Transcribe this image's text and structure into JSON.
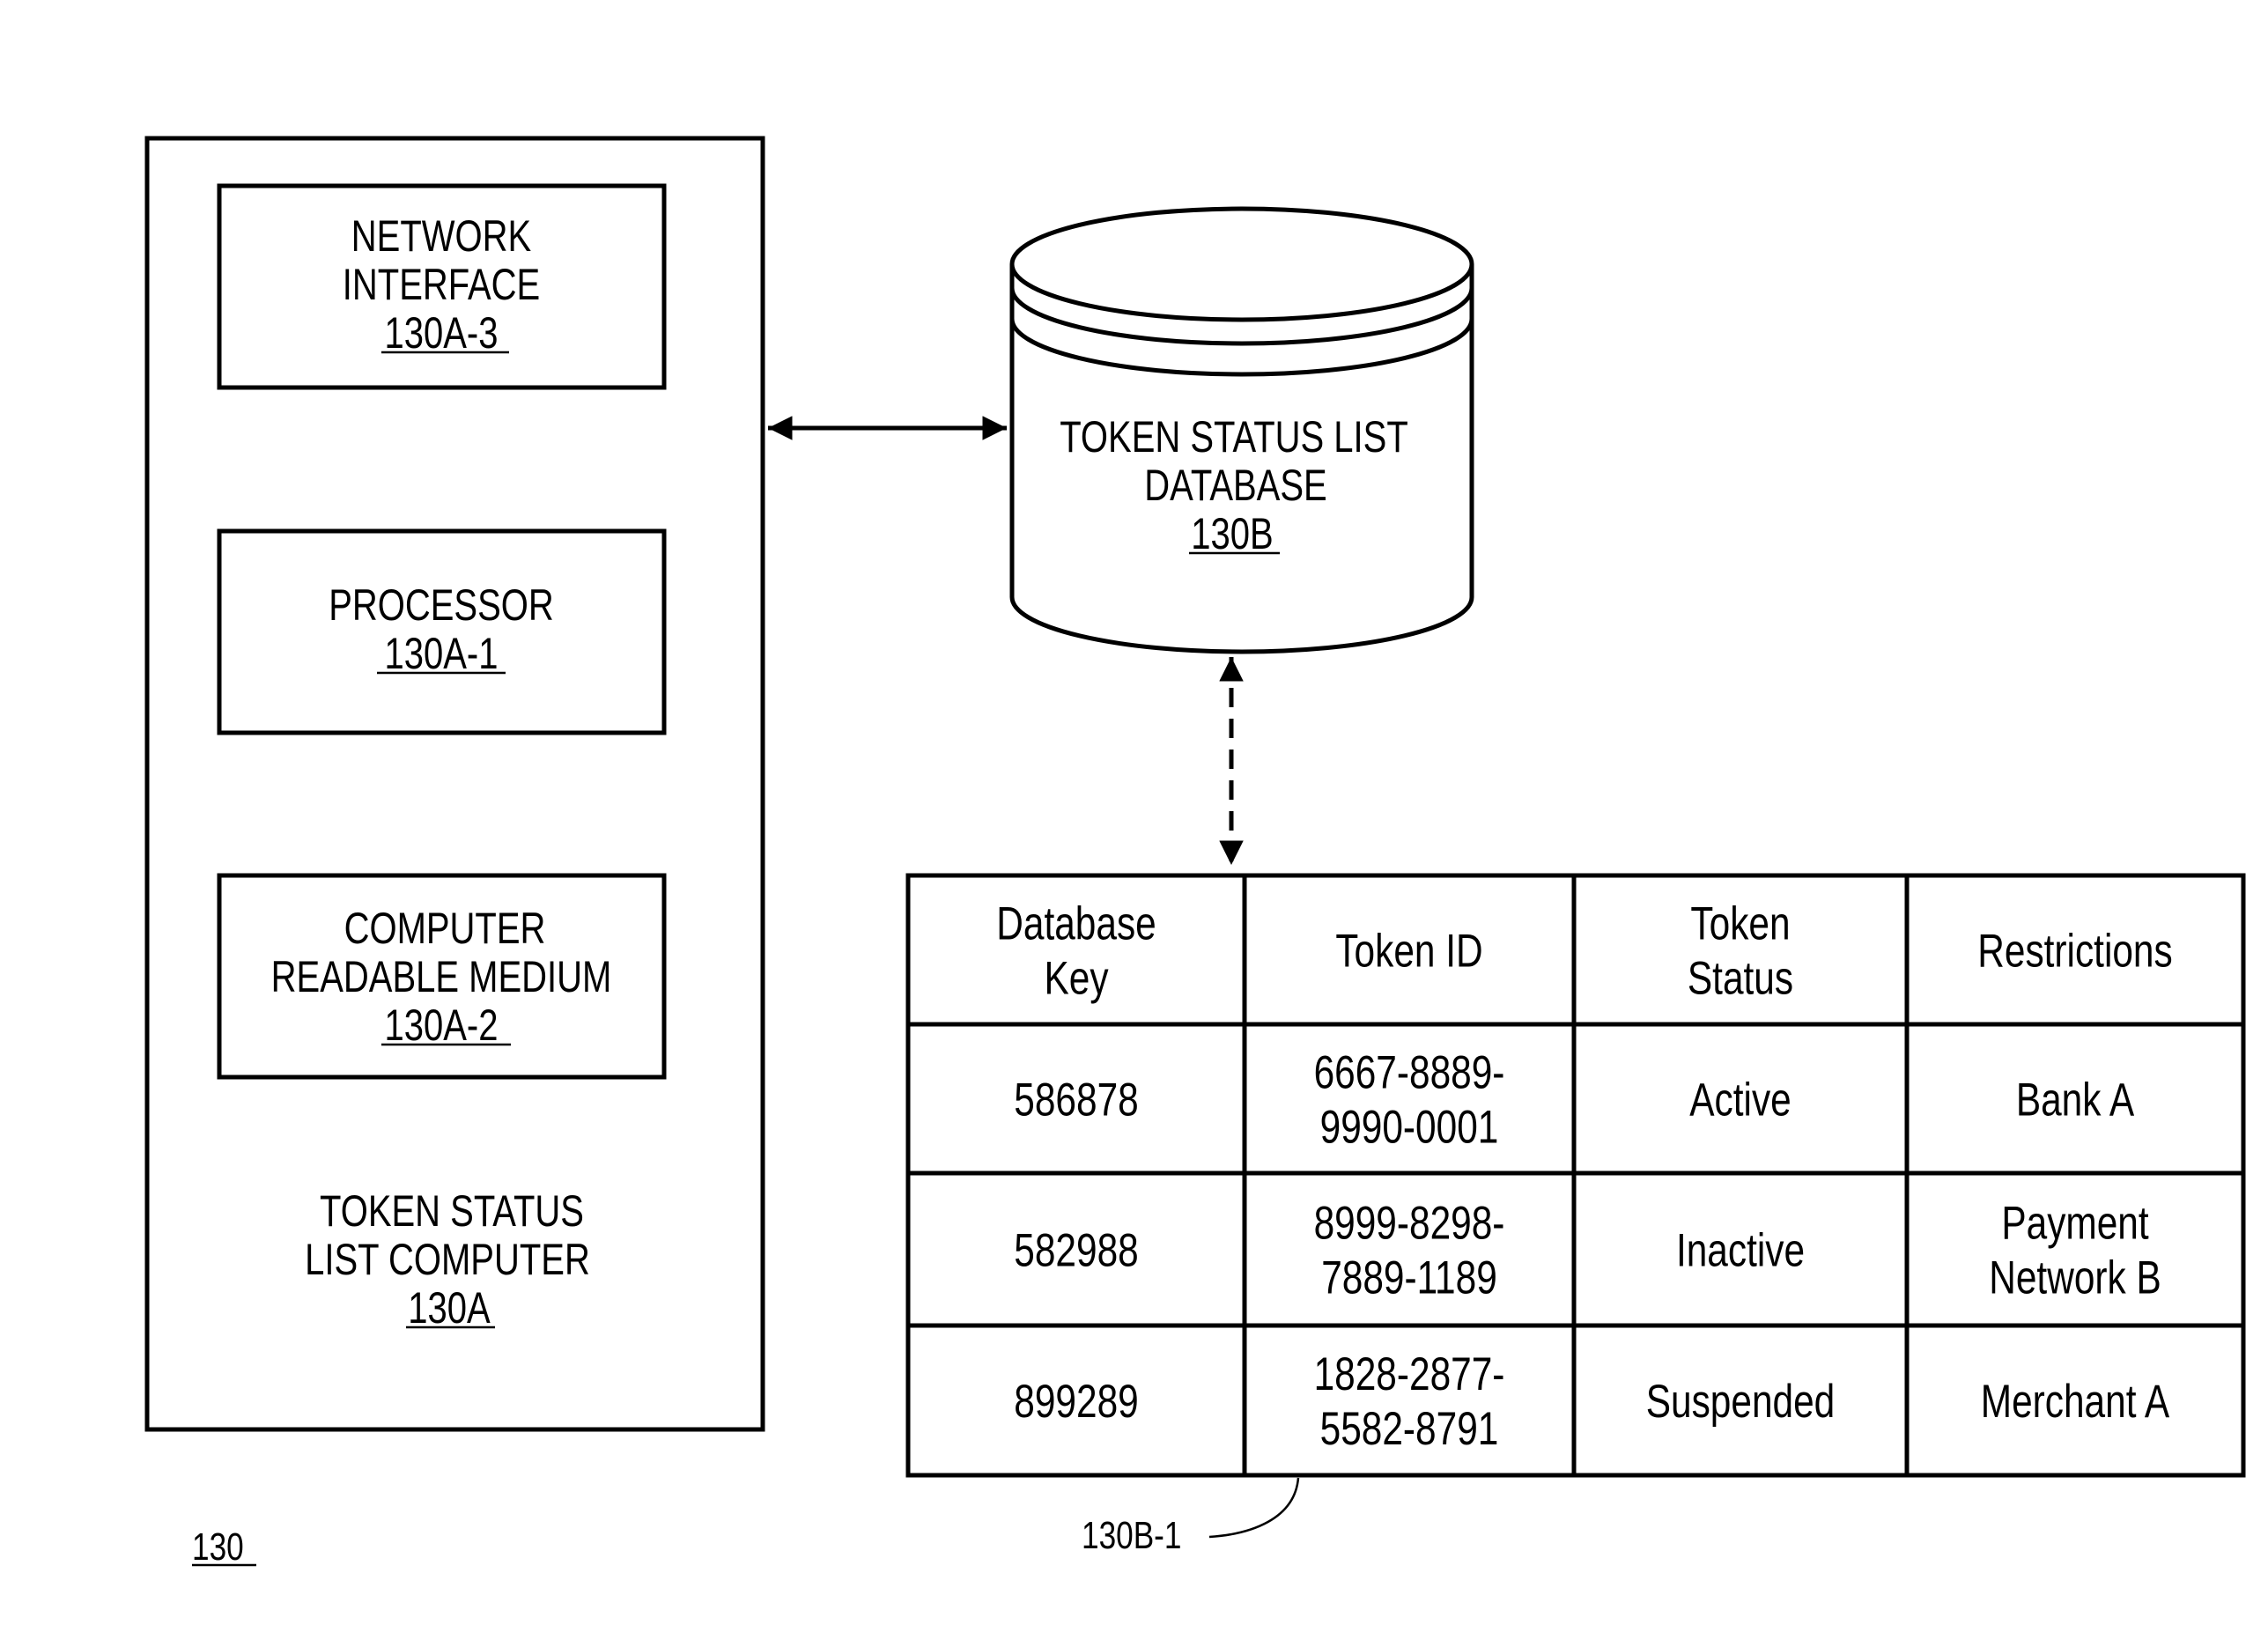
{
  "figure_ref": "130",
  "computer": {
    "title_lines": [
      "TOKEN STATUS",
      "LIST COMPUTER"
    ],
    "ref": "130A",
    "components": [
      {
        "lines": [
          "NETWORK",
          "INTERFACE"
        ],
        "ref": "130A-3"
      },
      {
        "lines": [
          "PROCESSOR"
        ],
        "ref": "130A-1"
      },
      {
        "lines": [
          "COMPUTER",
          "READABLE MEDIUM"
        ],
        "ref": "130A-2"
      }
    ]
  },
  "database": {
    "lines": [
      "TOKEN STATUS LIST",
      "DATABASE"
    ],
    "ref": "130B"
  },
  "table": {
    "ref": "130B-1",
    "headers": [
      [
        "Database",
        "Key"
      ],
      [
        "Token ID"
      ],
      [
        "Token",
        "Status"
      ],
      [
        "Restrictions"
      ]
    ],
    "rows": [
      [
        [
          "586878"
        ],
        [
          "6667-8889-",
          "9990-0001"
        ],
        [
          "Active"
        ],
        [
          "Bank A"
        ]
      ],
      [
        [
          "582988"
        ],
        [
          "8999-8298-",
          "7889-1189"
        ],
        [
          "Inactive"
        ],
        [
          "Payment",
          "Network B"
        ]
      ],
      [
        [
          "899289"
        ],
        [
          "1828-2877-",
          "5582-8791"
        ],
        [
          "Suspended"
        ],
        [
          "Merchant A"
        ]
      ]
    ]
  },
  "connections": [
    {
      "from": "token-status-list-computer",
      "to": "token-status-list-database",
      "style": "solid",
      "direction": "bidirectional"
    },
    {
      "from": "token-status-list-database",
      "to": "token-status-table",
      "style": "dashed",
      "direction": "bidirectional"
    }
  ]
}
